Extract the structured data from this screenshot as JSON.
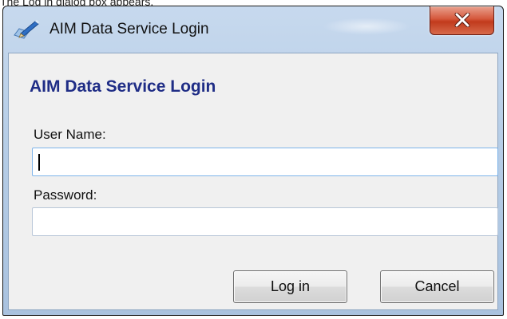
{
  "caption": "The Log in dialog box appears.",
  "window": {
    "title": "AIM Data Service Login",
    "app_icon": "pen-on-document-icon",
    "close_icon": "close-x-icon"
  },
  "form": {
    "heading": "AIM Data Service Login",
    "username_label": "User Name:",
    "username_value": "",
    "password_label": "Password:",
    "password_value": ""
  },
  "buttons": {
    "login_label": "Log in",
    "cancel_label": "Cancel"
  },
  "colors": {
    "heading": "#1f2d86",
    "title_bar": "#b6cde6",
    "close_button": "#c13a1c"
  }
}
